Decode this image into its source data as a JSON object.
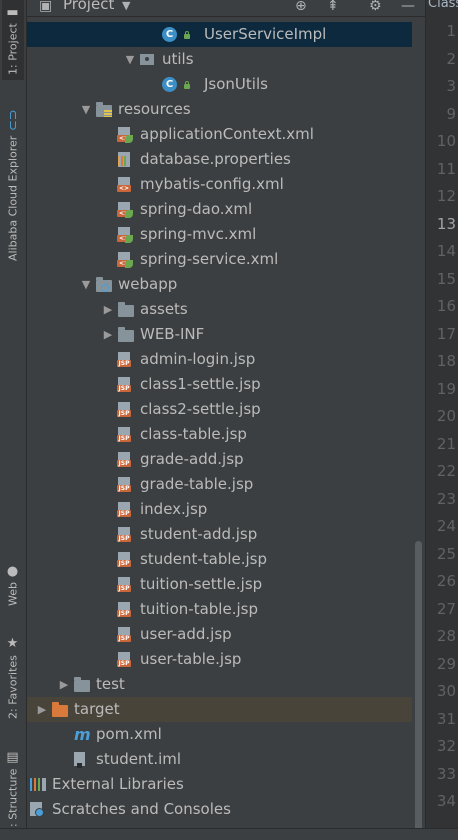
{
  "header": {
    "title": "Project",
    "icons": [
      "project-icon",
      "dropdown-icon",
      "locate-icon",
      "collapse-icon",
      "settings-icon",
      "hide-icon"
    ]
  },
  "editor": {
    "tab_title": "Class"
  },
  "left_strip": {
    "tabs": [
      {
        "label": "1: Project",
        "icon": "folder-icon"
      },
      {
        "label": "Alibaba Cloud Explorer",
        "icon": "alibaba-cloud-icon"
      },
      {
        "label": "Web",
        "icon": "web-icon"
      },
      {
        "label": "2: Favorites",
        "icon": "star-icon"
      },
      {
        "label": "7: Structure",
        "icon": "structure-icon"
      }
    ]
  },
  "tree": [
    {
      "label": "UserServiceImpl",
      "icon": "class",
      "indent": 5,
      "arrow": "",
      "selected": true
    },
    {
      "label": "utils",
      "icon": "package",
      "indent": 4,
      "arrow": "down"
    },
    {
      "label": "JsonUtils",
      "icon": "class",
      "indent": 5,
      "arrow": ""
    },
    {
      "label": "resources",
      "icon": "resources-folder",
      "indent": 2,
      "arrow": "down"
    },
    {
      "label": "applicationContext.xml",
      "icon": "spring-xml",
      "indent": 3,
      "arrow": ""
    },
    {
      "label": "database.properties",
      "icon": "properties",
      "indent": 3,
      "arrow": ""
    },
    {
      "label": "mybatis-config.xml",
      "icon": "xml",
      "indent": 3,
      "arrow": ""
    },
    {
      "label": "spring-dao.xml",
      "icon": "spring-xml",
      "indent": 3,
      "arrow": ""
    },
    {
      "label": "spring-mvc.xml",
      "icon": "spring-xml",
      "indent": 3,
      "arrow": ""
    },
    {
      "label": "spring-service.xml",
      "icon": "spring-xml",
      "indent": 3,
      "arrow": ""
    },
    {
      "label": "webapp",
      "icon": "web-folder",
      "indent": 2,
      "arrow": "down"
    },
    {
      "label": "assets",
      "icon": "folder",
      "indent": 3,
      "arrow": "right"
    },
    {
      "label": "WEB-INF",
      "icon": "folder",
      "indent": 3,
      "arrow": "right"
    },
    {
      "label": "admin-login.jsp",
      "icon": "jsp",
      "indent": 3,
      "arrow": ""
    },
    {
      "label": "class1-settle.jsp",
      "icon": "jsp",
      "indent": 3,
      "arrow": ""
    },
    {
      "label": "class2-settle.jsp",
      "icon": "jsp",
      "indent": 3,
      "arrow": ""
    },
    {
      "label": "class-table.jsp",
      "icon": "jsp",
      "indent": 3,
      "arrow": ""
    },
    {
      "label": "grade-add.jsp",
      "icon": "jsp",
      "indent": 3,
      "arrow": ""
    },
    {
      "label": "grade-table.jsp",
      "icon": "jsp",
      "indent": 3,
      "arrow": ""
    },
    {
      "label": "index.jsp",
      "icon": "jsp",
      "indent": 3,
      "arrow": ""
    },
    {
      "label": "student-add.jsp",
      "icon": "jsp",
      "indent": 3,
      "arrow": ""
    },
    {
      "label": "student-table.jsp",
      "icon": "jsp",
      "indent": 3,
      "arrow": ""
    },
    {
      "label": "tuition-settle.jsp",
      "icon": "jsp",
      "indent": 3,
      "arrow": ""
    },
    {
      "label": "tuition-table.jsp",
      "icon": "jsp",
      "indent": 3,
      "arrow": ""
    },
    {
      "label": "user-add.jsp",
      "icon": "jsp",
      "indent": 3,
      "arrow": ""
    },
    {
      "label": "user-table.jsp",
      "icon": "jsp",
      "indent": 3,
      "arrow": ""
    },
    {
      "label": "test",
      "icon": "folder",
      "indent": 1,
      "arrow": "right"
    },
    {
      "label": "target",
      "icon": "excluded-folder",
      "indent": 0,
      "arrow": "right",
      "excluded": true
    },
    {
      "label": "pom.xml",
      "icon": "maven",
      "indent": 1,
      "arrow": ""
    },
    {
      "label": "student.iml",
      "icon": "iml",
      "indent": 1,
      "arrow": ""
    },
    {
      "label": "External Libraries",
      "icon": "libraries",
      "indent": -1,
      "arrow": "right"
    },
    {
      "label": "Scratches and Consoles",
      "icon": "scratches",
      "indent": -1,
      "arrow": "right"
    }
  ],
  "line_numbers": [
    "1",
    "2",
    "3",
    "9",
    "10",
    "11",
    "12",
    "13",
    "14",
    "15",
    "16",
    "17",
    "18",
    "19",
    "20",
    "21",
    "22",
    "23",
    "24",
    "25",
    "26",
    "27",
    "28",
    "29",
    "30",
    "31",
    "32",
    "33",
    "34"
  ],
  "current_line": "13",
  "colors": {
    "background": "#3c3f41",
    "selection": "#0d293e",
    "excluded": "#49443a",
    "gutter": "#313335",
    "text": "#bbbbbb"
  }
}
